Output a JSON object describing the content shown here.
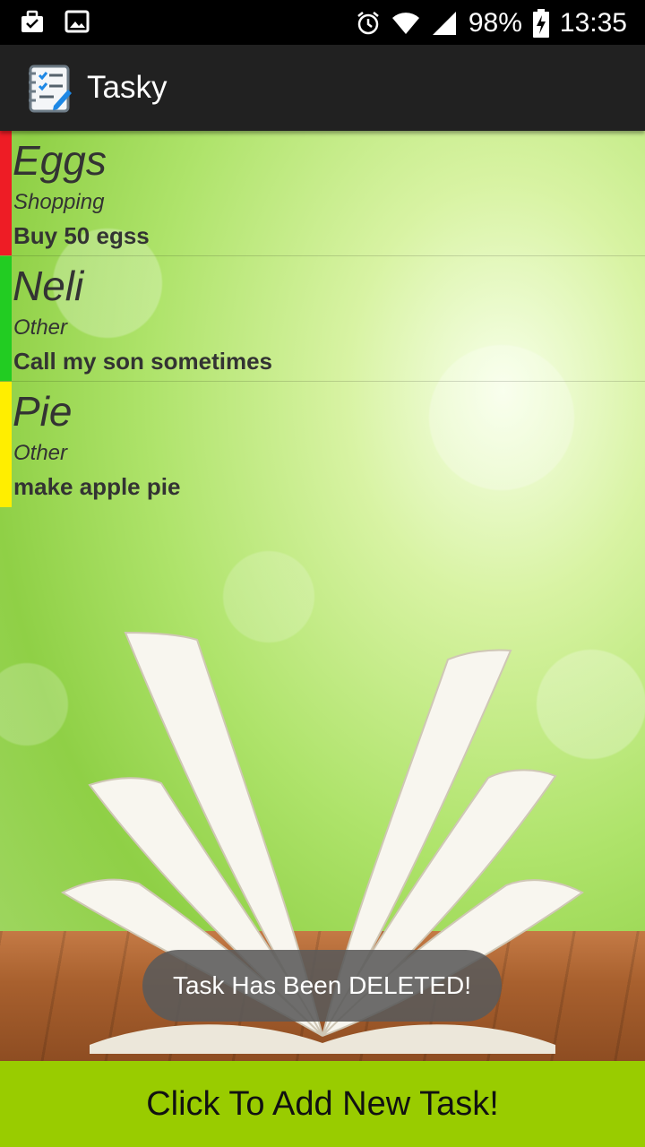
{
  "status_bar": {
    "battery": "98%",
    "time": "13:35",
    "icons": [
      "briefcase-icon",
      "image-icon",
      "alarm-icon",
      "wifi-icon",
      "signal-icon",
      "battery-charging-icon"
    ]
  },
  "app_bar": {
    "title": "Tasky",
    "logo_icon": "notepad-checklist-icon"
  },
  "tasks": [
    {
      "title": "Eggs",
      "category": "Shopping",
      "description": "Buy 50 egss",
      "priority_color": "#ee1c25"
    },
    {
      "title": "Neli",
      "category": "Other",
      "description": "Call my son sometimes",
      "priority_color": "#22cc22"
    },
    {
      "title": "Pie",
      "category": "Other",
      "description": "make apple pie",
      "priority_color": "#ffee00"
    }
  ],
  "toast": {
    "message": "Task Has Been DELETED!"
  },
  "add_button": {
    "label": "Click To Add New Task!",
    "color": "#99cc00"
  }
}
